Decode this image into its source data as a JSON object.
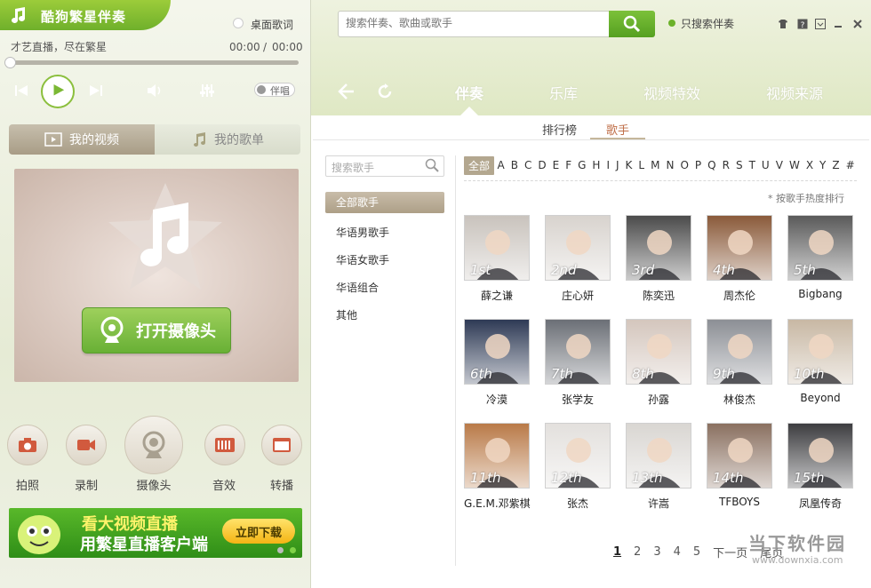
{
  "app": {
    "title": "酷狗繁星伴奏"
  },
  "player": {
    "lyrics_toggle_label": "桌面歌词",
    "now_playing": "才艺直播，尽在繁星",
    "time_current": "00:00",
    "time_separator": "/",
    "time_total": "00:00",
    "accomp_label": "伴唱",
    "progress": 0
  },
  "left_tabs": {
    "video": "我的视频",
    "songlist": "我的歌单"
  },
  "camera": {
    "open_button": "打开摄像头"
  },
  "tools": {
    "photo": "拍照",
    "record": "录制",
    "camera": "摄像头",
    "effects": "音效",
    "relay": "转播"
  },
  "banner": {
    "line1": "看大视频直播",
    "line2": "用繁星直播客户端",
    "button": "立即下载"
  },
  "search": {
    "placeholder": "搜索伴奏、歌曲或歌手",
    "only_accomp": "只搜索伴奏"
  },
  "nav": {
    "tabs": [
      "伴奏",
      "乐库",
      "视频特效",
      "视频来源"
    ],
    "active": "伴奏"
  },
  "subtabs": {
    "rank": "排行榜",
    "singer": "歌手",
    "active": "歌手"
  },
  "singer_search_placeholder": "搜索歌手",
  "categories": [
    "全部歌手",
    "华语男歌手",
    "华语女歌手",
    "华语组合",
    "其他"
  ],
  "alpha": {
    "all": "全部",
    "letters": [
      "A",
      "B",
      "C",
      "D",
      "E",
      "F",
      "G",
      "H",
      "I",
      "J",
      "K",
      "L",
      "M",
      "N",
      "O",
      "P",
      "Q",
      "R",
      "S",
      "T",
      "U",
      "V",
      "W",
      "X",
      "Y",
      "Z",
      "#"
    ]
  },
  "sort_hint": "* 按歌手热度排行",
  "singers": [
    {
      "rank": "1st",
      "name": "薛之谦",
      "bg": "#c9c3bd"
    },
    {
      "rank": "2nd",
      "name": "庄心妍",
      "bg": "#d8d3ce"
    },
    {
      "rank": "3rd",
      "name": "陈奕迅",
      "bg": "#4b4b4b"
    },
    {
      "rank": "4th",
      "name": "周杰伦",
      "bg": "#8a5a3a"
    },
    {
      "rank": "5th",
      "name": "Bigbang",
      "bg": "#5a5a5a"
    },
    {
      "rank": "6th",
      "name": "冷漠",
      "bg": "#2e3a55"
    },
    {
      "rank": "7th",
      "name": "张学友",
      "bg": "#6b6f76"
    },
    {
      "rank": "8th",
      "name": "孙露",
      "bg": "#d4c6bd"
    },
    {
      "rank": "9th",
      "name": "林俊杰",
      "bg": "#8c8f95"
    },
    {
      "rank": "10th",
      "name": "Beyond",
      "bg": "#c8b8a4"
    },
    {
      "rank": "11th",
      "name": "G.E.M.邓紫棋",
      "bg": "#b97a48"
    },
    {
      "rank": "12th",
      "name": "张杰",
      "bg": "#e3e0dd"
    },
    {
      "rank": "13th",
      "name": "许嵩",
      "bg": "#d9d6d2"
    },
    {
      "rank": "14th",
      "name": "TFBOYS",
      "bg": "#8a7060"
    },
    {
      "rank": "15th",
      "name": "凤凰传奇",
      "bg": "#3d3d40"
    }
  ],
  "pager": {
    "pages": [
      "1",
      "2",
      "3",
      "4",
      "5"
    ],
    "next": "下一页",
    "last": "尾页",
    "current": "1"
  },
  "watermark": {
    "name": "当下软件园",
    "url": "www.downxia.com"
  },
  "colors": {
    "accent_green": "#6fb02b",
    "tab_brown": "#ad9f87"
  }
}
